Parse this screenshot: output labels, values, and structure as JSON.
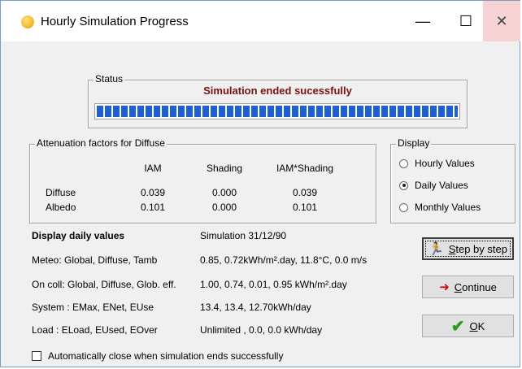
{
  "window": {
    "title": "Hourly Simulation Progress",
    "minimize": "—",
    "maximize": "☐",
    "close": "✕"
  },
  "status": {
    "label": "Status",
    "message": "Simulation ended sucessfully",
    "progress": 1.0
  },
  "attenuation": {
    "label": "Attenuation factors for Diffuse",
    "headers": [
      "IAM",
      "Shading",
      "IAM*Shading"
    ],
    "rows": [
      {
        "name": "Diffuse",
        "values": [
          "0.039",
          "0.000",
          "0.039"
        ]
      },
      {
        "name": "Albedo",
        "values": [
          "0.101",
          "0.000",
          "0.101"
        ]
      }
    ]
  },
  "display": {
    "label": "Display",
    "options": [
      "Hourly Values",
      "Daily Values",
      "Monthly Values"
    ],
    "selected": "Daily Values"
  },
  "info": {
    "heading": "Display daily values",
    "simulation": "Simulation 31/12/90",
    "rows": [
      {
        "label": "Meteo:  Global,  Diffuse, Tamb",
        "value": "0.85,  0.72kWh/m².day,  11.8°C,  0.0 m/s"
      },
      {
        "label": "On coll: Global,  Diffuse, Glob. eff.",
        "value": "1.00,  0.74,  0.01,  0.95 kWh/m².day"
      },
      {
        "label": "System : EMax, ENet, EUse",
        "value": "13.4,  13.4,  12.70kWh/day"
      },
      {
        "label": "Load :  ELoad, EUsed, EOver",
        "value": "Unlimited ,  0.0,  0.0 kWh/day"
      }
    ]
  },
  "buttons": {
    "step": {
      "prefix": "",
      "mnemonic": "S",
      "rest": "tep by step"
    },
    "continue": {
      "mnemonic": "C",
      "rest": "ontinue"
    },
    "ok": {
      "mnemonic": "O",
      "rest": "K"
    }
  },
  "auto_close": {
    "label": "Automatically close when simulation ends successfully",
    "checked": false
  }
}
